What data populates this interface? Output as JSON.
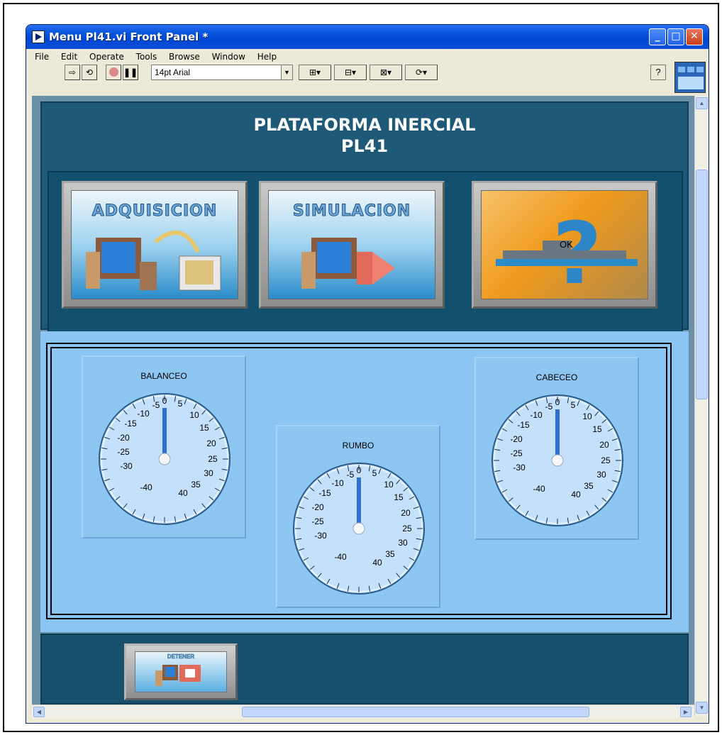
{
  "window": {
    "title": "Menu Pl41.vi Front Panel *",
    "minimize": "_",
    "maximize": "□",
    "close": "✕"
  },
  "menu": [
    "File",
    "Edit",
    "Operate",
    "Tools",
    "Browse",
    "Window",
    "Help"
  ],
  "toolbar": {
    "font_select": "14pt Arial",
    "help": "?"
  },
  "panel": {
    "title_line1": "PLATAFORMA INERCIAL",
    "title_line2": "PL41"
  },
  "buttons": {
    "adquisicion": "ADQUISICION",
    "simulacion": "SIMULACION",
    "help_ok": "OK",
    "detener": "DETENER"
  },
  "gauges": [
    {
      "label": "BALANCEO",
      "value": 0
    },
    {
      "label": "RUMBO",
      "value": 0
    },
    {
      "label": "CABECEO",
      "value": 0
    }
  ],
  "gauge_scale_labels": {
    "left": [
      "-5",
      "-10",
      "-15",
      "-20",
      "-25",
      "-30",
      "-40"
    ],
    "right": [
      "0",
      "5",
      "10",
      "15",
      "20",
      "25",
      "30",
      "35",
      "40"
    ]
  },
  "colors": {
    "panel_dark": "#1e5a78",
    "gauge_bg": "#8bc5f3",
    "needle": "#2f6fd0"
  }
}
